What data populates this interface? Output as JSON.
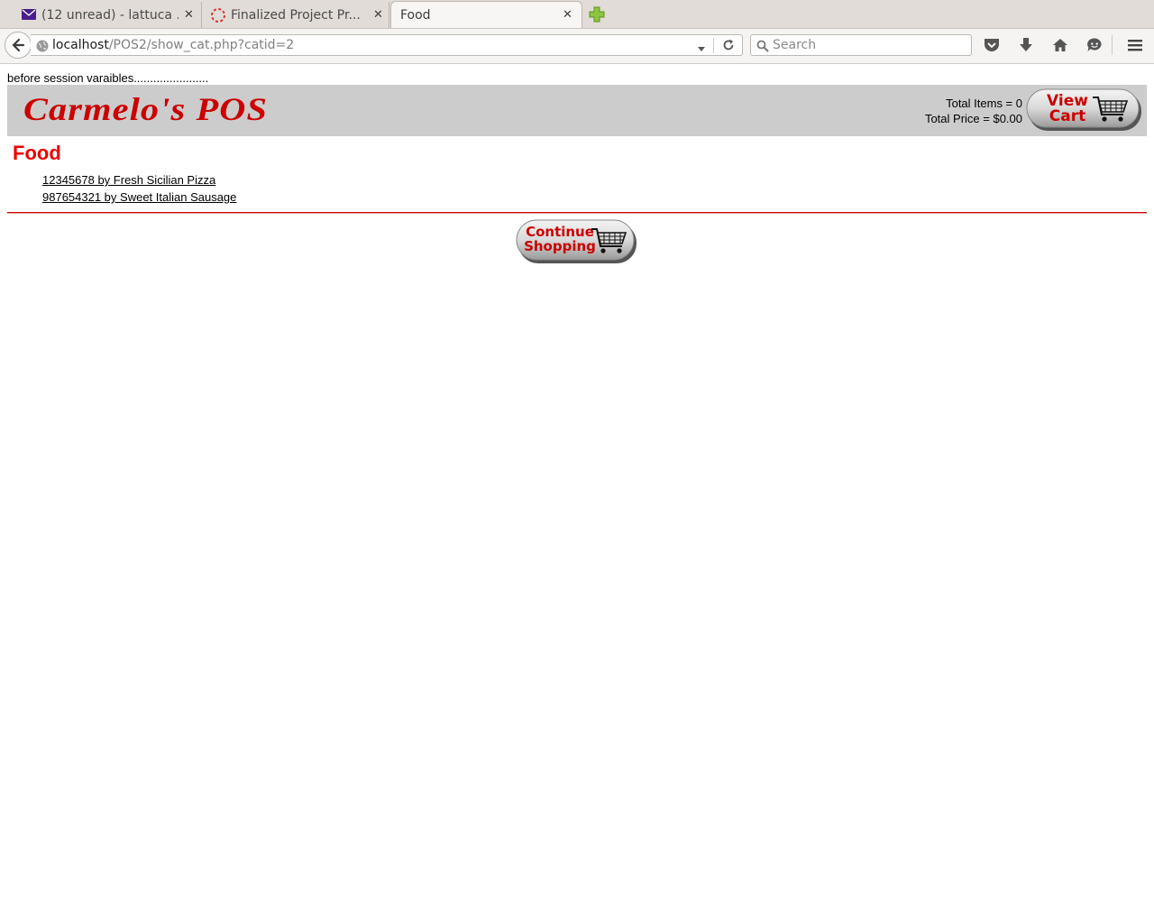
{
  "browser": {
    "tabs": [
      {
        "label": "(12 unread) - lattuca ...",
        "icon": "mail-icon"
      },
      {
        "label": "Finalized Project Pr...",
        "icon": "loading-spinner-icon"
      },
      {
        "label": "Food",
        "icon": null
      }
    ],
    "url_host": "localhost",
    "url_path": "/POS2/show_cat.php?catid=2",
    "search_placeholder": "Search"
  },
  "page": {
    "debug_text": "before session varaibles.......................",
    "logo_text": "Carmelo's POS",
    "total_items": "Total Items = 0",
    "total_price": "Total Price = $0.00",
    "view_cart_line1": "View",
    "view_cart_line2": "Cart",
    "category_title": "Food",
    "items": [
      "12345678 by Fresh Sicilian Pizza",
      "987654321 by Sweet Italian Sausage"
    ],
    "continue_line1": "Continue",
    "continue_line2": "Shopping"
  },
  "colors": {
    "brand_red": "#cc0000",
    "title_red": "#ee0000",
    "banner_gray": "#cccccc"
  }
}
